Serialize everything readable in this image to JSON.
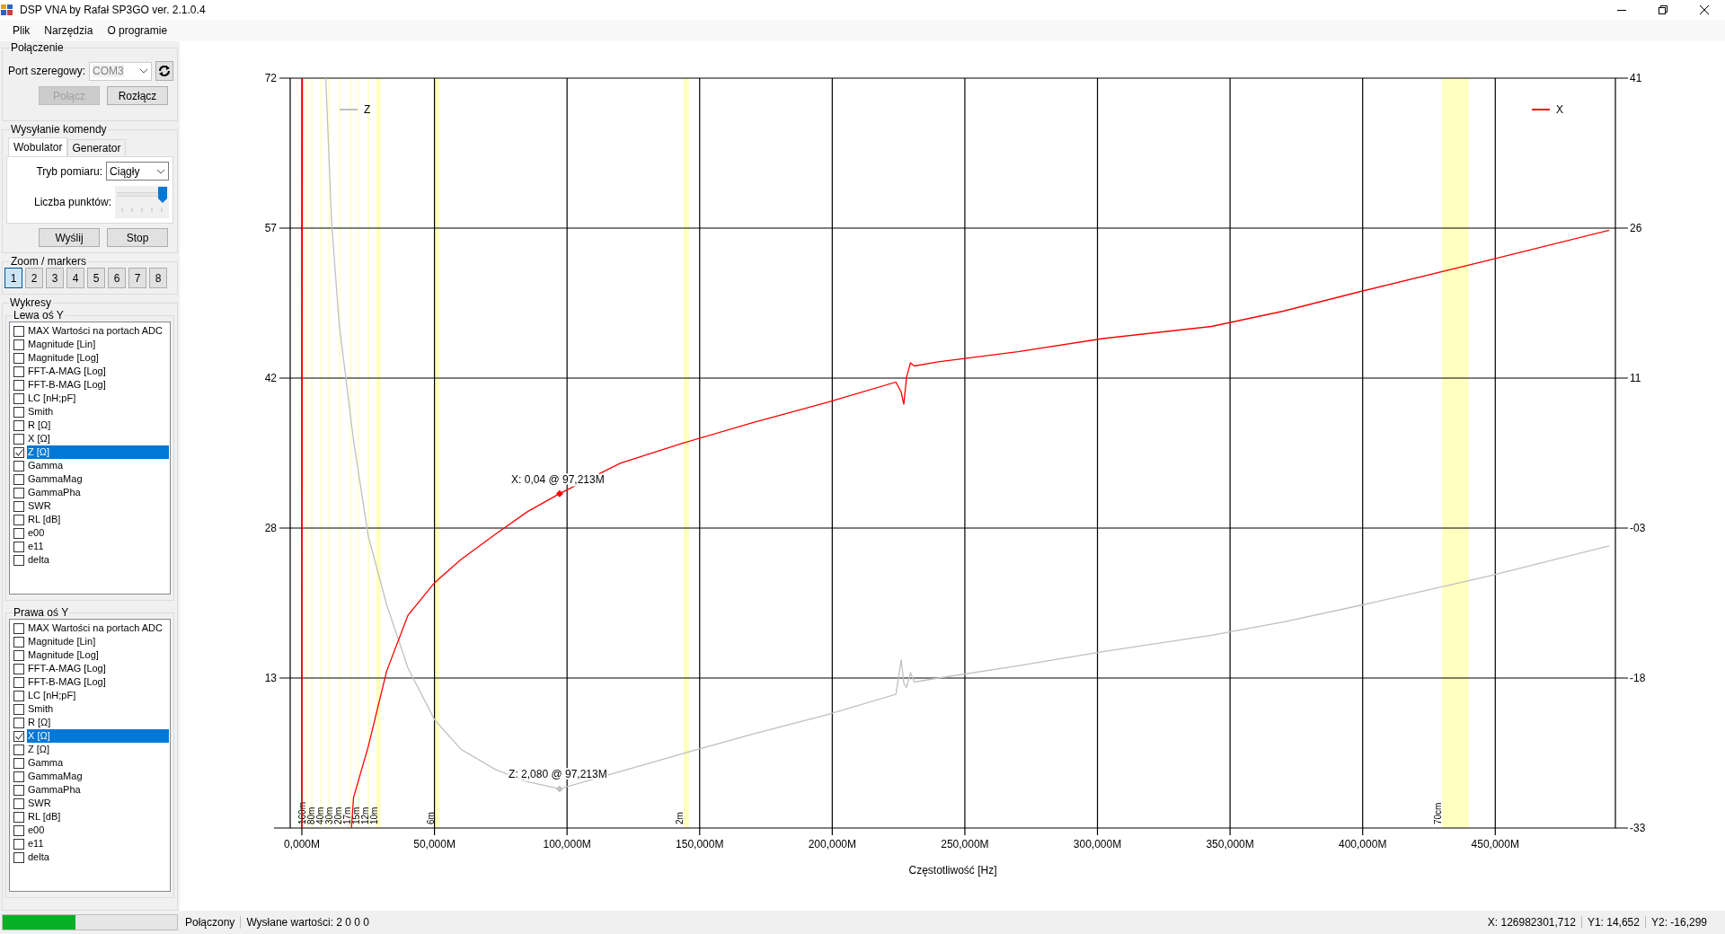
{
  "window": {
    "title": "DSP VNA by Rafał SP3GO ver. 2.1.0.4"
  },
  "menu": [
    {
      "label": "Plik"
    },
    {
      "label": "Narzędzia"
    },
    {
      "label": "O programie"
    }
  ],
  "connection": {
    "title": "Połączenie",
    "port_label": "Port szeregowy:",
    "port": {
      "value": "COM3",
      "disabled": true
    },
    "buttons": [
      {
        "label": "Połącz",
        "disabled": true
      },
      {
        "label": "Rozłącz",
        "disabled": false
      }
    ]
  },
  "command": {
    "title": "Wysyłanie komendy",
    "tabs": [
      {
        "label": "Wobulator",
        "selected": true
      },
      {
        "label": "Generator",
        "selected": false
      }
    ],
    "mode_label": "Tryb pomiaru:",
    "mode_value": "Ciągły",
    "points_label": "Liczba punktów:",
    "points_slider": {
      "level": 1
    },
    "buttons": [
      {
        "label": "Wyślij"
      },
      {
        "label": "Stop"
      }
    ]
  },
  "zoom": {
    "title": "Zoom / markers",
    "buttons": [
      {
        "label": "1",
        "selected": true
      },
      {
        "label": "2",
        "selected": false
      },
      {
        "label": "3",
        "selected": false
      },
      {
        "label": "4",
        "selected": false
      },
      {
        "label": "5",
        "selected": false
      },
      {
        "label": "6",
        "selected": false
      },
      {
        "label": "7",
        "selected": false
      },
      {
        "label": "8",
        "selected": false
      }
    ]
  },
  "charts": {
    "title": "Wykresy",
    "left_axis": {
      "title": "Lewa oś Y",
      "items": [
        {
          "label": "MAX Wartości na portach ADC",
          "checked": false,
          "selected": false
        },
        {
          "label": "Magnitude [Lin]",
          "checked": false,
          "selected": false
        },
        {
          "label": "Magnitude [Log]",
          "checked": false,
          "selected": false
        },
        {
          "label": "FFT-A-MAG [Log]",
          "checked": false,
          "selected": false
        },
        {
          "label": "FFT-B-MAG [Log]",
          "checked": false,
          "selected": false
        },
        {
          "label": "LC [nH;pF]",
          "checked": false,
          "selected": false
        },
        {
          "label": "Smith",
          "checked": false,
          "selected": false
        },
        {
          "label": "R [Ω]",
          "checked": false,
          "selected": false
        },
        {
          "label": "X [Ω]",
          "checked": false,
          "selected": false
        },
        {
          "label": "Z [Ω]",
          "checked": true,
          "selected": true
        },
        {
          "label": "Gamma",
          "checked": false,
          "selected": false
        },
        {
          "label": "GammaMag",
          "checked": false,
          "selected": false
        },
        {
          "label": "GammaPha",
          "checked": false,
          "selected": false
        },
        {
          "label": "SWR",
          "checked": false,
          "selected": false
        },
        {
          "label": "RL [dB]",
          "checked": false,
          "selected": false
        },
        {
          "label": "e00",
          "checked": false,
          "selected": false
        },
        {
          "label": "e11",
          "checked": false,
          "selected": false
        },
        {
          "label": "delta",
          "checked": false,
          "selected": false
        }
      ]
    },
    "right_axis": {
      "title": "Prawa oś Y",
      "items": [
        {
          "label": "MAX Wartości na portach ADC",
          "checked": false,
          "selected": false
        },
        {
          "label": "Magnitude [Lin]",
          "checked": false,
          "selected": false
        },
        {
          "label": "Magnitude [Log]",
          "checked": false,
          "selected": false
        },
        {
          "label": "FFT-A-MAG [Log]",
          "checked": false,
          "selected": false
        },
        {
          "label": "FFT-B-MAG [Log]",
          "checked": false,
          "selected": false
        },
        {
          "label": "LC [nH;pF]",
          "checked": false,
          "selected": false
        },
        {
          "label": "Smith",
          "checked": false,
          "selected": false
        },
        {
          "label": "R [Ω]",
          "checked": false,
          "selected": false
        },
        {
          "label": "X [Ω]",
          "checked": true,
          "selected": true
        },
        {
          "label": "Z [Ω]",
          "checked": false,
          "selected": false
        },
        {
          "label": "Gamma",
          "checked": false,
          "selected": false
        },
        {
          "label": "GammaMag",
          "checked": false,
          "selected": false
        },
        {
          "label": "GammaPha",
          "checked": false,
          "selected": false
        },
        {
          "label": "SWR",
          "checked": false,
          "selected": false
        },
        {
          "label": "RL [dB]",
          "checked": false,
          "selected": false
        },
        {
          "label": "e00",
          "checked": false,
          "selected": false
        },
        {
          "label": "e11",
          "checked": false,
          "selected": false
        },
        {
          "label": "delta",
          "checked": false,
          "selected": false
        }
      ]
    }
  },
  "plot": {
    "chart_data": {
      "type": "line",
      "xlabel": "Częstotliwość [Hz]",
      "x": [
        0,
        0.2,
        9,
        11.2,
        14,
        18.7,
        19.5,
        25,
        32,
        40,
        50,
        60,
        73,
        85,
        97.2,
        120,
        144,
        170,
        198,
        224,
        226,
        227,
        228,
        229.5,
        231,
        240,
        270,
        302,
        343,
        370,
        400,
        447,
        493
      ],
      "series": [
        {
          "name": "Z",
          "color": "#c0c0c0",
          "values": [
            null,
            null,
            72,
            58,
            48,
            38,
            36.4,
            27,
            20.2,
            14,
            8.9,
            6,
            4,
            2.8,
            2.1,
            3.8,
            5.6,
            7.5,
            9.4,
            11.4,
            14.8,
            12.5,
            12.1,
            13.5,
            12.6,
            13,
            14.2,
            15.6,
            17.2,
            18.5,
            20.2,
            23,
            26
          ]
        },
        {
          "name": "X",
          "color": "#ff0000",
          "axis": "y2",
          "values": [
            -33,
            41,
            null,
            null,
            null,
            -33,
            -30,
            -25,
            -17.5,
            -12,
            -8.8,
            -6.5,
            -4,
            -1.8,
            0,
            3,
            5,
            7,
            9,
            11,
            10,
            8.8,
            11.5,
            12.9,
            12.6,
            13,
            14,
            15.3,
            16.5,
            18,
            20,
            23,
            26
          ]
        }
      ],
      "xlim": [
        -4.4,
        495.3
      ],
      "ylim": [
        -1.75,
        72
      ],
      "y2lim": [
        -33,
        41
      ],
      "xticks": [
        {
          "value": 0,
          "label": "0,000M"
        },
        {
          "value": 50,
          "label": "50,000M"
        },
        {
          "value": 100,
          "label": "100,000M"
        },
        {
          "value": 150,
          "label": "150,000M"
        },
        {
          "value": 200,
          "label": "200,000M"
        },
        {
          "value": 250,
          "label": "250,000M"
        },
        {
          "value": 300,
          "label": "300,000M"
        },
        {
          "value": 350,
          "label": "350,000M"
        },
        {
          "value": 400,
          "label": "400,000M"
        },
        {
          "value": 450,
          "label": "450,000M"
        }
      ],
      "yticks": [
        {
          "value": 72,
          "label": "72"
        },
        {
          "value": 57.25,
          "label": "57"
        },
        {
          "value": 42.5,
          "label": "42"
        },
        {
          "value": 27.75,
          "label": "28"
        },
        {
          "value": 13,
          "label": "13"
        }
      ],
      "y2ticks": [
        {
          "value": 41,
          "label": "41"
        },
        {
          "value": 26.2,
          "label": "26"
        },
        {
          "value": 11.4,
          "label": "11"
        },
        {
          "value": -3.4,
          "label": "-03"
        },
        {
          "value": -18.2,
          "label": "-18"
        },
        {
          "value": -33,
          "label": "-33"
        }
      ],
      "bands": [
        {
          "axis": "x",
          "label": "160m",
          "from": 1.8,
          "to": 2.0
        },
        {
          "axis": "x",
          "label": "80m",
          "from": 3.5,
          "to": 3.8
        },
        {
          "axis": "x",
          "label": "40m",
          "from": 7.0,
          "to": 7.2
        },
        {
          "axis": "x",
          "label": "30m",
          "from": 10.1,
          "to": 10.2
        },
        {
          "axis": "x",
          "label": "20m",
          "from": 14.0,
          "to": 14.4
        },
        {
          "axis": "x",
          "label": "17m",
          "from": 18.1,
          "to": 18.2
        },
        {
          "axis": "x",
          "label": "15m",
          "from": 21.0,
          "to": 21.5
        },
        {
          "axis": "x",
          "label": "12m",
          "from": 24.9,
          "to": 25.0
        },
        {
          "axis": "x",
          "label": "10m",
          "from": 28.0,
          "to": 29.7
        },
        {
          "axis": "x",
          "label": "6m",
          "from": 50,
          "to": 52
        },
        {
          "axis": "x",
          "label": "2m",
          "from": 144,
          "to": 146
        },
        {
          "axis": "x",
          "label": "70cm",
          "from": 430,
          "to": 440
        }
      ],
      "grid": true,
      "legend": "top",
      "annotations": [
        {
          "text": "Z: 2,080 @ 97,213M",
          "x": 97.2,
          "y": 2.1
        },
        "X: 0,04 @ 97,213M"
      ]
    }
  },
  "status_bar": {
    "progress": {
      "level": 0.42
    },
    "connection": "Połączony",
    "sent": "Wysłane wartości: 2 0 0 0",
    "x": "X: 126982301,712",
    "y1": "Y1: 14,652",
    "y2": "Y2: -16,299"
  }
}
